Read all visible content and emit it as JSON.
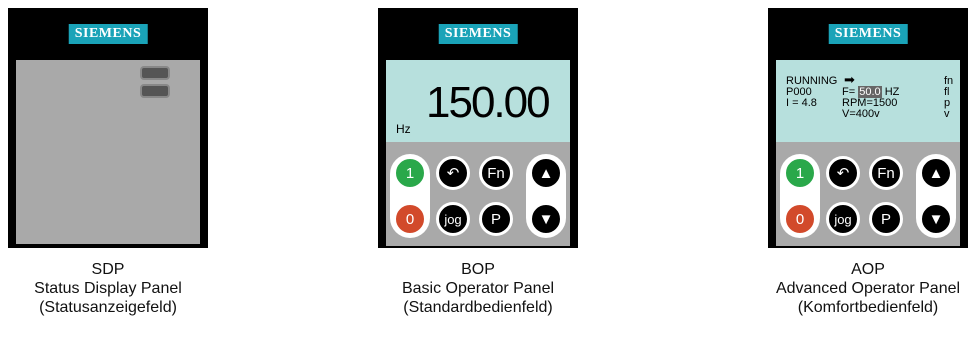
{
  "brand": "SIEMENS",
  "panels": {
    "sdp": {
      "code": "SDP",
      "name": "Status Display Panel",
      "name_de": "(Statusanzeigefeld)"
    },
    "bop": {
      "code": "BOP",
      "name": "Basic Operator Panel",
      "name_de": "(Standardbedienfeld)",
      "display_value": "150.00",
      "display_unit": "Hz"
    },
    "aop": {
      "code": "AOP",
      "name": "Advanced Operator Panel",
      "name_de": "(Komfortbedienfeld)",
      "status": "RUNNING",
      "param": "P000",
      "current": "I = 4.8",
      "freq_prefix": "F=",
      "freq_value": "50.0",
      "freq_unit": "HZ",
      "rpm": "RPM=1500",
      "volt": "V=400v",
      "side_labels": [
        "fn",
        "fl",
        "p",
        "v"
      ]
    }
  },
  "keys": {
    "on": "1",
    "off": "0",
    "reverse": "↶",
    "fn": "Fn",
    "jog": "jog",
    "p": "P",
    "up": "▲",
    "down": "▼"
  },
  "colors": {
    "brand": "#1aa3b8",
    "lcd": "#b7e0dd",
    "on_key": "#2aa84a",
    "off_key": "#d24a2b"
  }
}
